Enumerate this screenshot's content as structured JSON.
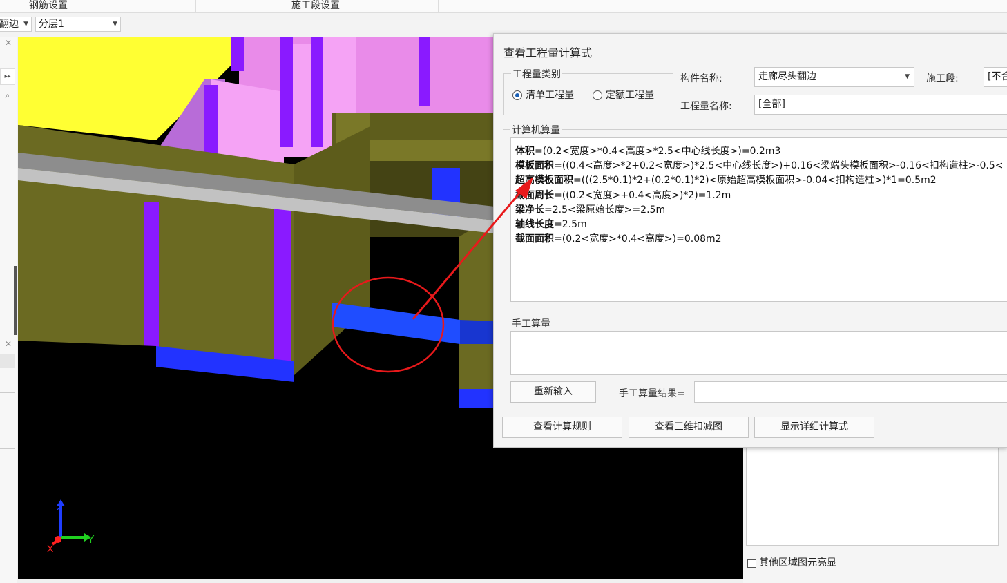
{
  "topbar": {
    "tab1": "钢筋设置",
    "tab2": "施工段设置"
  },
  "toolbar": {
    "combo1": "翻边",
    "combo2": "分层1"
  },
  "viewport": {
    "axis_z": "Z",
    "axis_y": "Y",
    "axis_x": "X"
  },
  "dialog": {
    "title": "查看工程量计算式",
    "qty_type_legend": "工程量类别",
    "radio_list": "清单工程量",
    "radio_quota": "定额工程量",
    "component_label": "构件名称:",
    "component_value": "走廊尽头翻边",
    "stage_label": "施工段:",
    "stage_value": "[不合",
    "qty_name_label": "工程量名称:",
    "qty_name_value": "[全部]",
    "computer_legend": "计算机算量",
    "formulas": [
      {
        "name": "体积",
        "expr": "=(0.2<宽度>*0.4<高度>*2.5<中心线长度>)=0.2m3"
      },
      {
        "name": "模板面积",
        "expr": "=((0.4<高度>*2+0.2<宽度>)*2.5<中心线长度>)+0.16<梁端头模板面积>-0.16<扣构造柱>-0.5<"
      },
      {
        "name": "超高模板面积",
        "expr": "=(((2.5*0.1)*2+(0.2*0.1)*2)<原始超高模板面积>-0.04<扣构造柱>)*1=0.5m2"
      },
      {
        "name": "截面周长",
        "expr": "=((0.2<宽度>+0.4<高度>)*2)=1.2m"
      },
      {
        "name": "梁净长",
        "expr": "=2.5<梁原始长度>=2.5m"
      },
      {
        "name": "轴线长度",
        "expr": "=2.5m"
      },
      {
        "name": "截面面积",
        "expr": "=(0.2<宽度>*0.4<高度>)=0.08m2"
      }
    ],
    "manual_legend": "手工算量",
    "reinput_button": "重新输入",
    "manual_result_label": "手工算量结果=",
    "manual_result_value": "",
    "rules_button": "查看计算规则",
    "deduct3d_button": "查看三维扣减图",
    "detail_button": "显示详细计算式"
  },
  "rightpanel": {
    "highlight_checkbox": "其他区域图元亮显"
  },
  "colors": {
    "yellow_wall": "#ffff33",
    "olive_beam": "#6b6a22",
    "pink_column": "#f5a3f5",
    "purple_edge": "#8a1aff",
    "blue_base": "#1f4dff",
    "annotation_red": "#e8191b"
  }
}
